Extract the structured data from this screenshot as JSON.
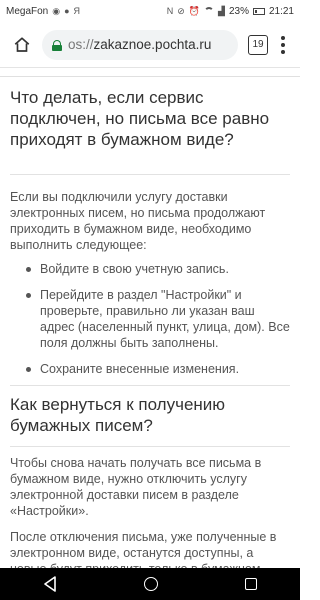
{
  "status_bar": {
    "carrier": "MegaFon",
    "app_letter": "Я",
    "battery": "23%",
    "time": "21:21"
  },
  "browser": {
    "url_prefix": "os://",
    "url_domain": "zakaznoe.pochta.ru",
    "tab_count": "19"
  },
  "article": {
    "heading1": "Что делать, если сервис подключен, но письма все равно приходят в бумажном виде?",
    "intro": "Если вы подключили услугу доставки электронных писем, но письма продолжают приходить в бумажном виде, необходимо выполнить следующее:",
    "steps": [
      "Войдите в свою учетную запись.",
      "Перейдите в раздел \"Настройки\" и проверьте, правильно ли указан ваш адрес (населенный пункт, улица, дом). Все поля должны быть заполнены.",
      "Сохраните внесенные изменения."
    ],
    "heading2": "Как вернуться к получению бумажных писем?",
    "para1": "Чтобы снова начать получать все письма в бумажном виде, нужно отключить услугу электронной доставки писем в разделе «Настройки».",
    "para2": "После отключения письма, уже полученные в электронном виде, останутся доступны, а новые будут приходить только в бумажном виде. В любой момент можно снова подключить доставку электронных писем."
  }
}
